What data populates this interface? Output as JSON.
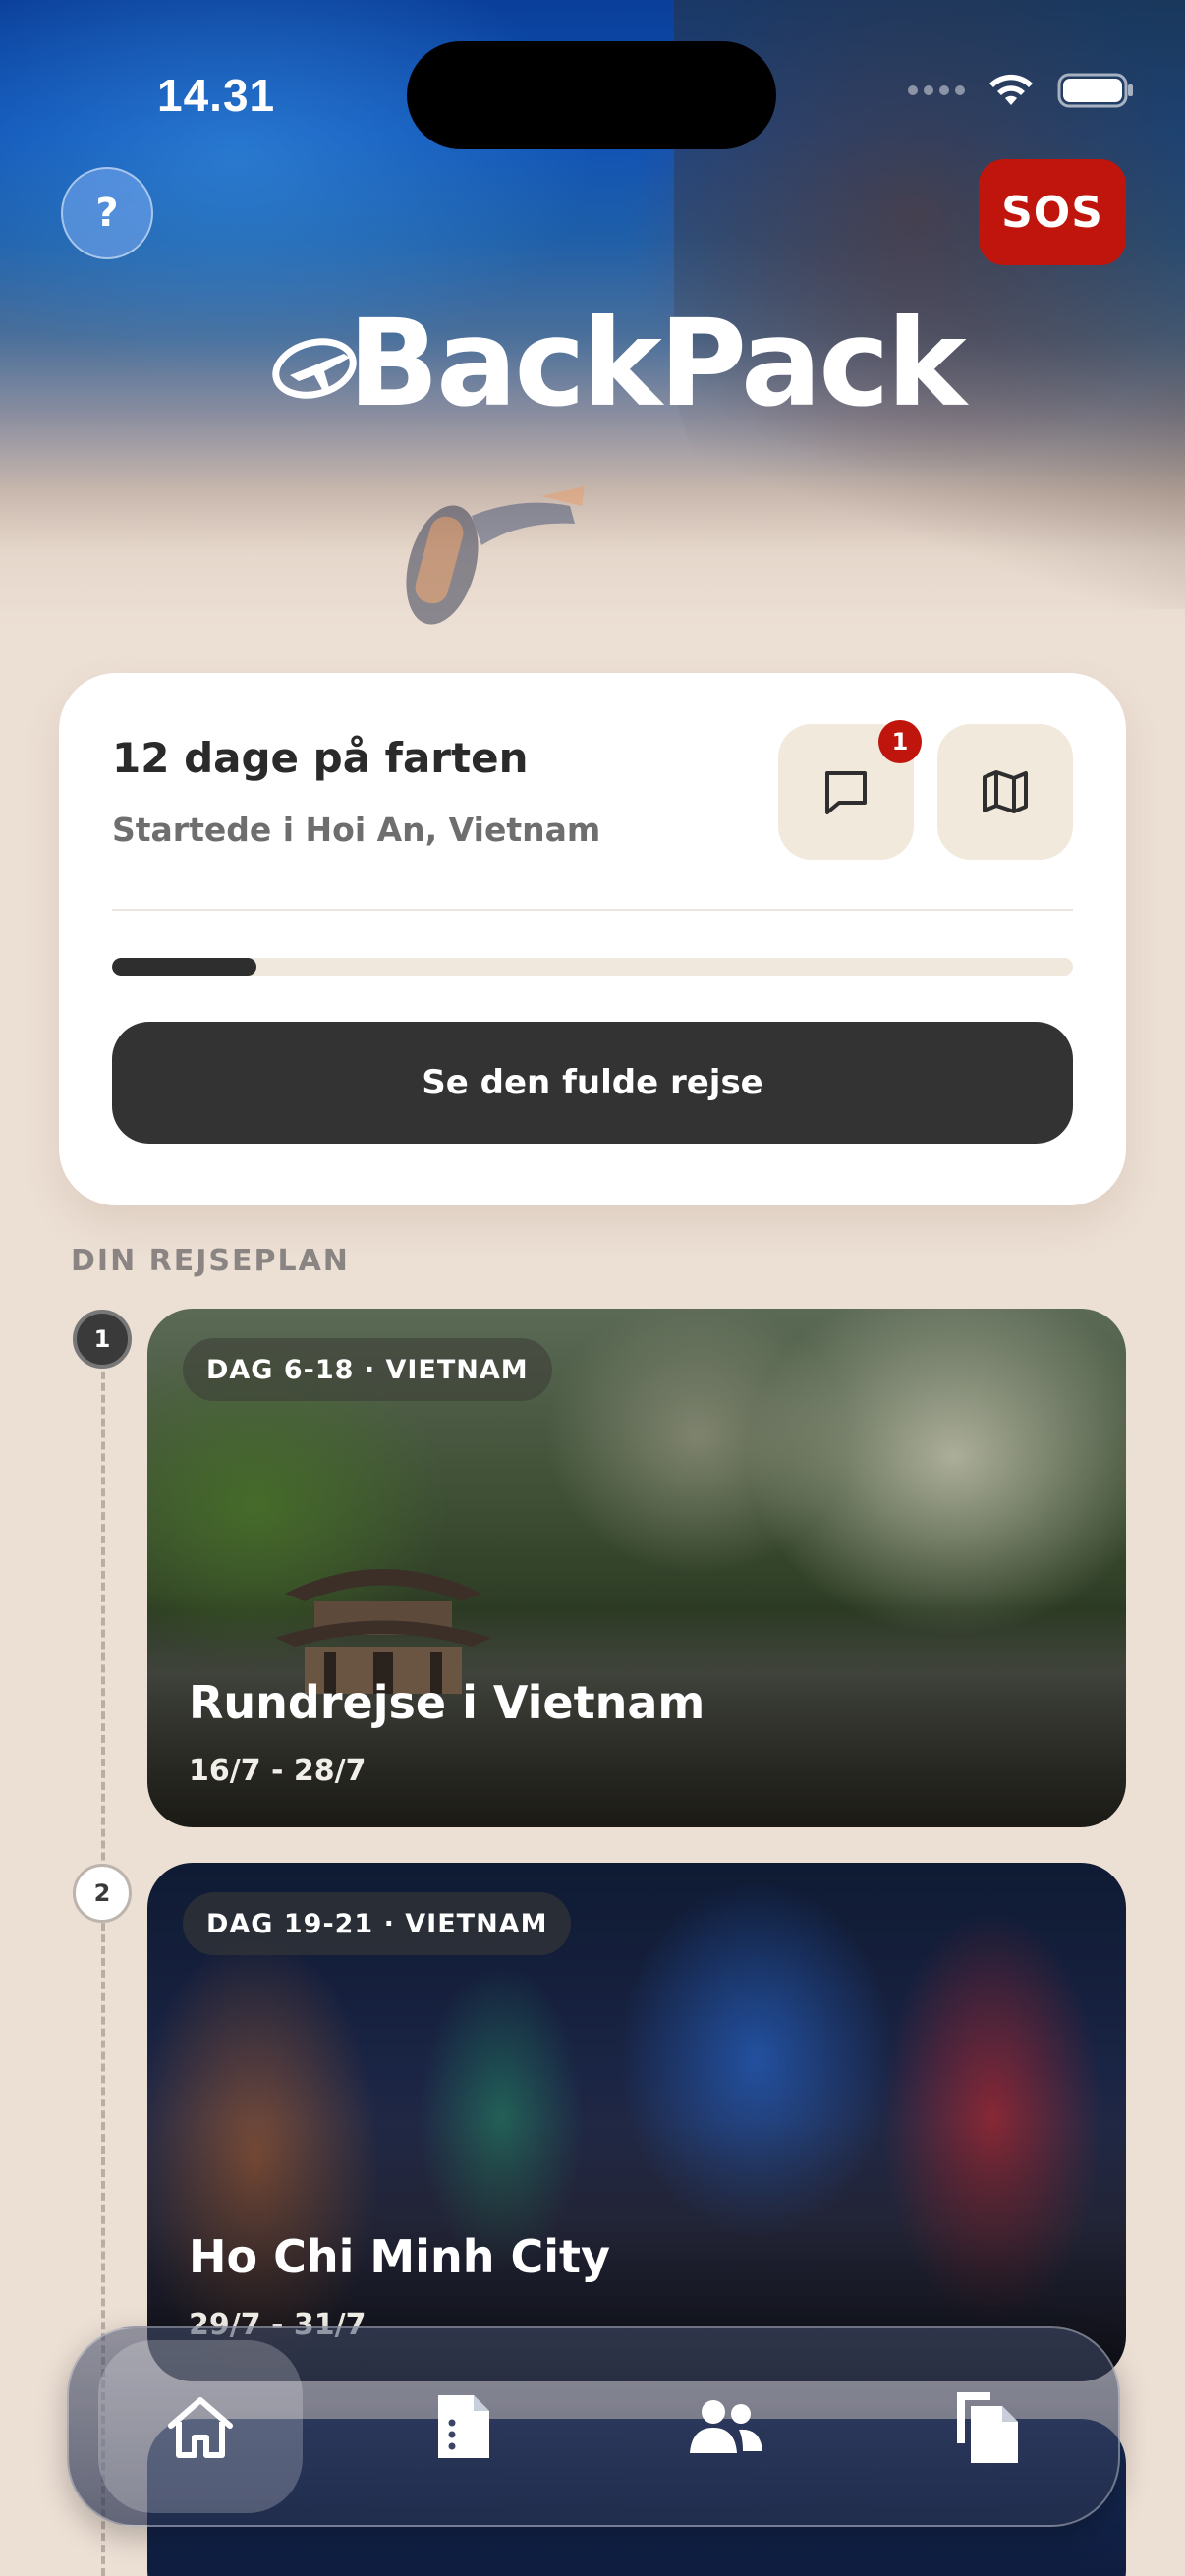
{
  "status_bar": {
    "time": "14.31"
  },
  "header": {
    "help_label": "?",
    "sos_label": "SOS",
    "logo_text": "BackPack"
  },
  "trip_card": {
    "title": "12 dage på farten",
    "subtitle": "Startede i Hoi An, Vietnam",
    "message_badge": "1",
    "progress_fraction": 0.15,
    "full_trip_button": "Se den fulde rejse"
  },
  "itinerary": {
    "section_title": "DIN REJSEPLAN",
    "items": [
      {
        "step": "1",
        "tag": "DAG 6-18 · VIETNAM",
        "name": "Rundrejse i Vietnam",
        "dates": "16/7 - 28/7"
      },
      {
        "step": "2",
        "tag": "DAG 19-21 · VIETNAM",
        "name": "Ho Chi Minh City",
        "dates": "29/7 - 31/7"
      }
    ]
  },
  "tab_bar": {
    "tabs": [
      {
        "icon": "home-icon",
        "active": true
      },
      {
        "icon": "document-icon",
        "active": false
      },
      {
        "icon": "people-icon",
        "active": false
      },
      {
        "icon": "copy-icon",
        "active": false
      }
    ]
  },
  "colors": {
    "sos": "#c0150d",
    "primary_button": "#333333",
    "background": "#ecdfd4",
    "accent_card": "#f1eadc"
  }
}
